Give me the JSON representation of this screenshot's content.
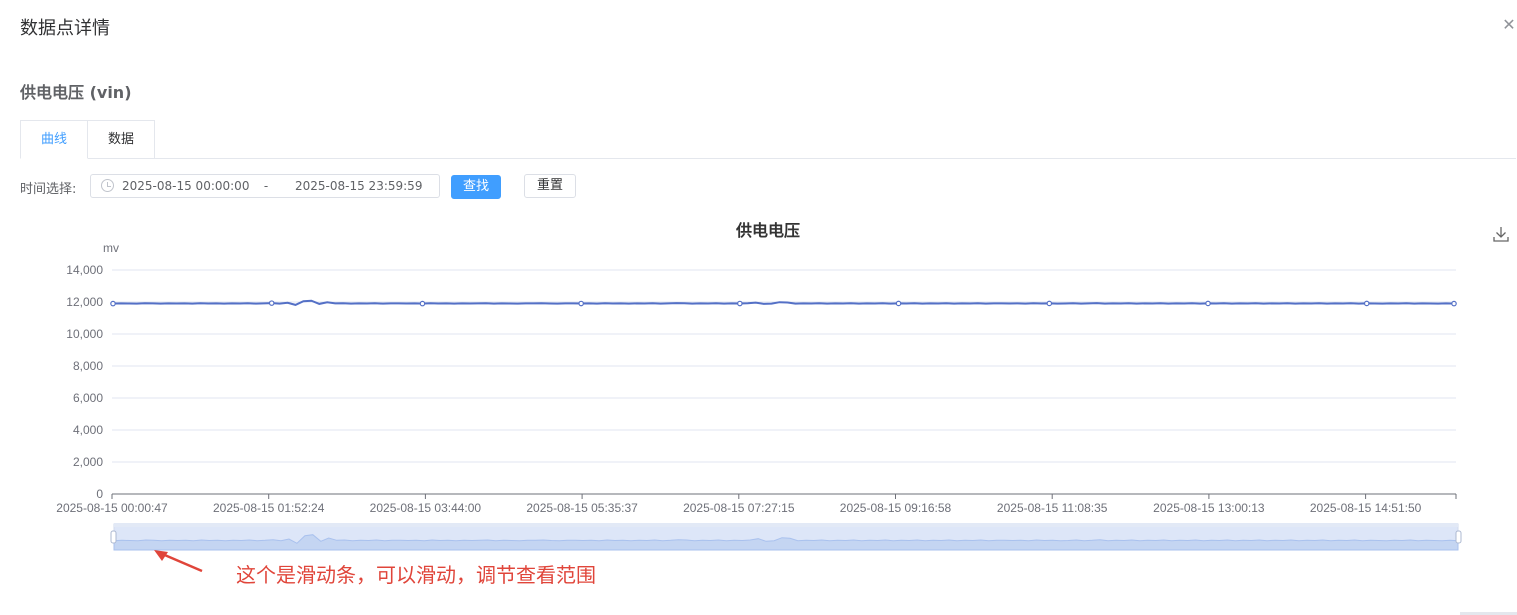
{
  "dialog": {
    "title": "数据点详情",
    "close_icon": "close-icon"
  },
  "point": {
    "title": "供电电压 (vin)"
  },
  "tabs": [
    {
      "label": "曲线",
      "active": true
    },
    {
      "label": "数据",
      "active": false
    }
  ],
  "filter": {
    "label": "时间选择:",
    "start": "2025-08-15 00:00:00",
    "separator": "-",
    "end": "2025-08-15 23:59:59",
    "search_label": "查找",
    "reset_label": "重置",
    "clock_icon": "clock-icon"
  },
  "toolbox": {
    "download_icon": "download-icon"
  },
  "annotation": {
    "text": "这个是滑动条，可以滑动，调节查看范围",
    "color": "#e0453a"
  },
  "colors": {
    "accent": "#409eff",
    "series_line": "#5470c6",
    "slider_fill": "#dde6f8"
  },
  "chart_data": {
    "type": "line",
    "title": "供电电压",
    "ylabel": "mv",
    "xlabel": "",
    "ylim": [
      0,
      14000
    ],
    "yticks": [
      "0",
      "2,000",
      "4,000",
      "6,000",
      "8,000",
      "10,000",
      "12,000",
      "14,000"
    ],
    "xticks": [
      "2025-08-15 00:00:47",
      "2025-08-15 01:52:24",
      "2025-08-15 03:44:00",
      "2025-08-15 05:35:37",
      "2025-08-15 07:27:15",
      "2025-08-15 09:16:58",
      "2025-08-15 11:08:35",
      "2025-08-15 13:00:13",
      "2025-08-15 14:51:50"
    ],
    "grid": true,
    "legend": "none",
    "dataZoom": "slider-bottom",
    "series": [
      {
        "values": [
          11900,
          11910,
          11905,
          11900,
          11920,
          11910,
          11900,
          11915,
          11905,
          11910,
          11900,
          11920,
          11905,
          11910,
          11900,
          11915,
          11905,
          11920,
          11900,
          11910,
          11930,
          11900,
          11950,
          11820,
          12050,
          12080,
          11880,
          11980,
          11910,
          11920,
          11900,
          11910,
          11905,
          11920,
          11900,
          11910,
          11915,
          11905,
          11910,
          11900,
          11920,
          11905,
          11910,
          11900,
          11915,
          11905,
          11910,
          11920,
          11900,
          11910,
          11905,
          11900,
          11915,
          11910,
          11920,
          11905,
          11900,
          11910,
          11915,
          11905,
          11910,
          11900,
          11920,
          11905,
          11910,
          11900,
          11915,
          11905,
          11920,
          11900,
          11910,
          11930,
          11920,
          11900,
          11910,
          11905,
          11920,
          11900,
          11910,
          11905,
          11920,
          11960,
          11880,
          11900,
          11990,
          11970,
          11900,
          11910,
          11905,
          11920,
          11900,
          11910,
          11905,
          11920,
          11900,
          11910,
          11905,
          11920,
          11900,
          11910,
          11905,
          11920,
          11900,
          11910,
          11905,
          11920,
          11900,
          11910,
          11905,
          11920,
          11900,
          11910,
          11915,
          11905,
          11910,
          11900,
          11920,
          11905,
          11910,
          11900,
          11905,
          11920,
          11900,
          11910,
          11930,
          11900,
          11910,
          11905,
          11920,
          11900,
          11910,
          11905,
          11920,
          11900,
          11910,
          11905,
          11920,
          11900,
          11910,
          11905,
          11920,
          11900,
          11910,
          11905,
          11920,
          11900,
          11910,
          11905,
          11920,
          11900,
          11910,
          11905,
          11920,
          11900,
          11910,
          11905,
          11920,
          11900,
          11910,
          11905,
          11900,
          11910,
          11905,
          11920,
          11900,
          11910,
          11905,
          11900,
          11910,
          11900
        ]
      }
    ]
  }
}
